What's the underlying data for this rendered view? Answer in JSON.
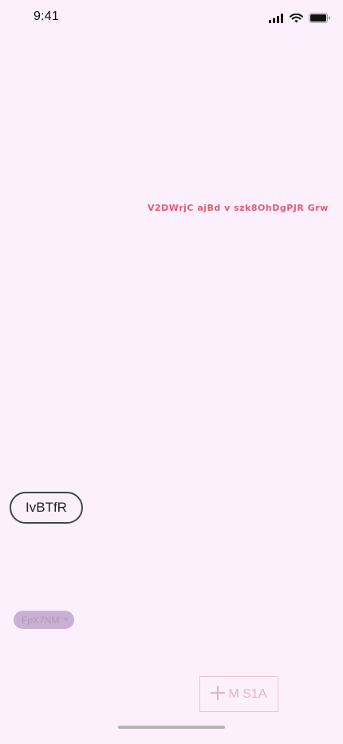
{
  "status_bar": {
    "time": "9:41",
    "icons": [
      "signal-icon",
      "wifi-icon",
      "battery-icon"
    ]
  },
  "content": {
    "overlay_text": "V2DWrjC ajBd v szk8OhDgPJR Grw",
    "pill_button_label": "IvBTfR",
    "chip_label": "FpX7NM",
    "chip_close_glyph": "×",
    "add_button_label": "M S1A"
  },
  "colors": {
    "background": "#fcf0fd",
    "accent_text": "#e25b74",
    "chip_background": "#c9b1d4",
    "add_button_border": "#ebc5ce"
  }
}
